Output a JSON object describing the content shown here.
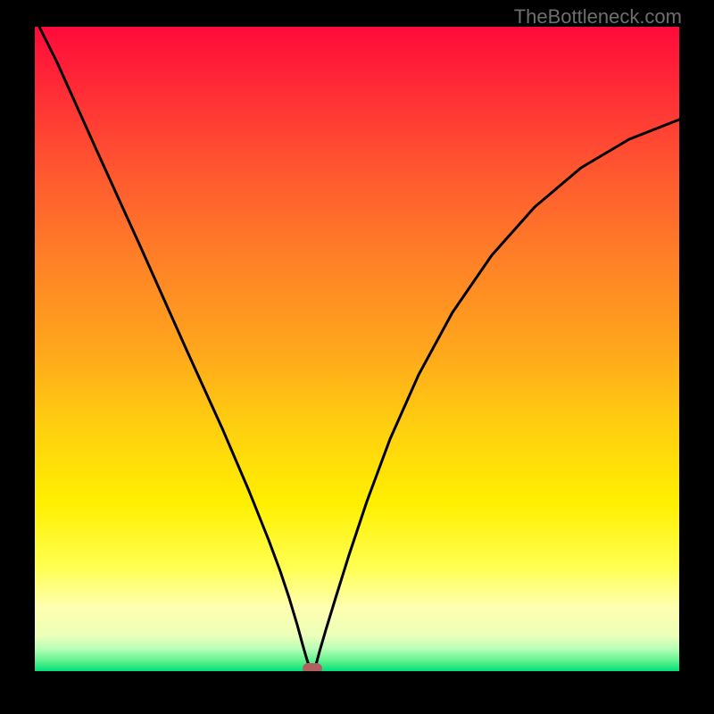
{
  "watermark": "TheBottleneck.com",
  "chart_data": {
    "type": "line",
    "title": "",
    "xlabel": "",
    "ylabel": "",
    "xlim": [
      0,
      100
    ],
    "ylim": [
      0,
      100
    ],
    "grid": false,
    "legend": false,
    "series": [
      {
        "name": "bottleneck-curve",
        "x": [
          0,
          3.5,
          9.7,
          16.6,
          23.5,
          29.1,
          33.2,
          36.3,
          38.1,
          39.5,
          40.7,
          41.6,
          42.1,
          42.5,
          42.7,
          42.8,
          43.1,
          43.4,
          43.6,
          44.2,
          45.2,
          46.7,
          48.8,
          51.5,
          55.1,
          59.6,
          64.8,
          70.9,
          77.6,
          84.8,
          92.2,
          100
        ],
        "y": [
          101,
          94.5,
          80.6,
          65.4,
          49.9,
          37.7,
          28.0,
          20.4,
          15.5,
          11.4,
          7.2,
          4.2,
          2.2,
          1.1,
          0.6,
          0.3,
          0.3,
          0.7,
          1.4,
          3.1,
          6.4,
          11.4,
          18.0,
          26.3,
          36.0,
          46.0,
          55.7,
          64.5,
          72.0,
          78.1,
          82.5,
          85.6
        ]
      }
    ],
    "annotations": [
      {
        "name": "optimal-point",
        "x": 43.1,
        "y": 0.3,
        "marker": "oval",
        "color": "#b16060"
      }
    ],
    "background": {
      "type": "vertical-gradient",
      "stops": [
        {
          "pos": 0.0,
          "color": "#ff0a3a"
        },
        {
          "pos": 0.1,
          "color": "#ff2d36"
        },
        {
          "pos": 0.22,
          "color": "#ff5630"
        },
        {
          "pos": 0.35,
          "color": "#ff7d28"
        },
        {
          "pos": 0.5,
          "color": "#ffa61c"
        },
        {
          "pos": 0.62,
          "color": "#ffcf10"
        },
        {
          "pos": 0.74,
          "color": "#fff000"
        },
        {
          "pos": 0.84,
          "color": "#ffff53"
        },
        {
          "pos": 0.9,
          "color": "#ffffb0"
        },
        {
          "pos": 0.945,
          "color": "#ecffb8"
        },
        {
          "pos": 0.965,
          "color": "#b8ffb8"
        },
        {
          "pos": 0.985,
          "color": "#5af08c"
        },
        {
          "pos": 1.0,
          "color": "#00e07a"
        }
      ]
    }
  }
}
